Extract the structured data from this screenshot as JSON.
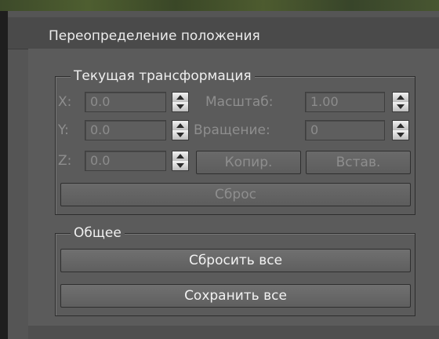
{
  "window": {
    "title": "Переопределение положения"
  },
  "current_transform": {
    "group_title": "Текущая трансформация",
    "x": {
      "label": "X:",
      "value": "0.0"
    },
    "y": {
      "label": "Y:",
      "value": "0.0"
    },
    "z": {
      "label": "Z:",
      "value": "0.0"
    },
    "scale": {
      "label": "Масштаб:",
      "value": "1.00"
    },
    "rotation": {
      "label": "Вращение:",
      "value": "0"
    },
    "copy_label": "Копир.",
    "paste_label": "Встав.",
    "reset_label": "Сброс"
  },
  "general": {
    "group_title": "Общее",
    "reset_all_label": "Сбросить все",
    "save_all_label": "Сохранить все"
  },
  "icons": {
    "spin_up": "arrow-up-icon",
    "spin_down": "arrow-down-icon"
  }
}
